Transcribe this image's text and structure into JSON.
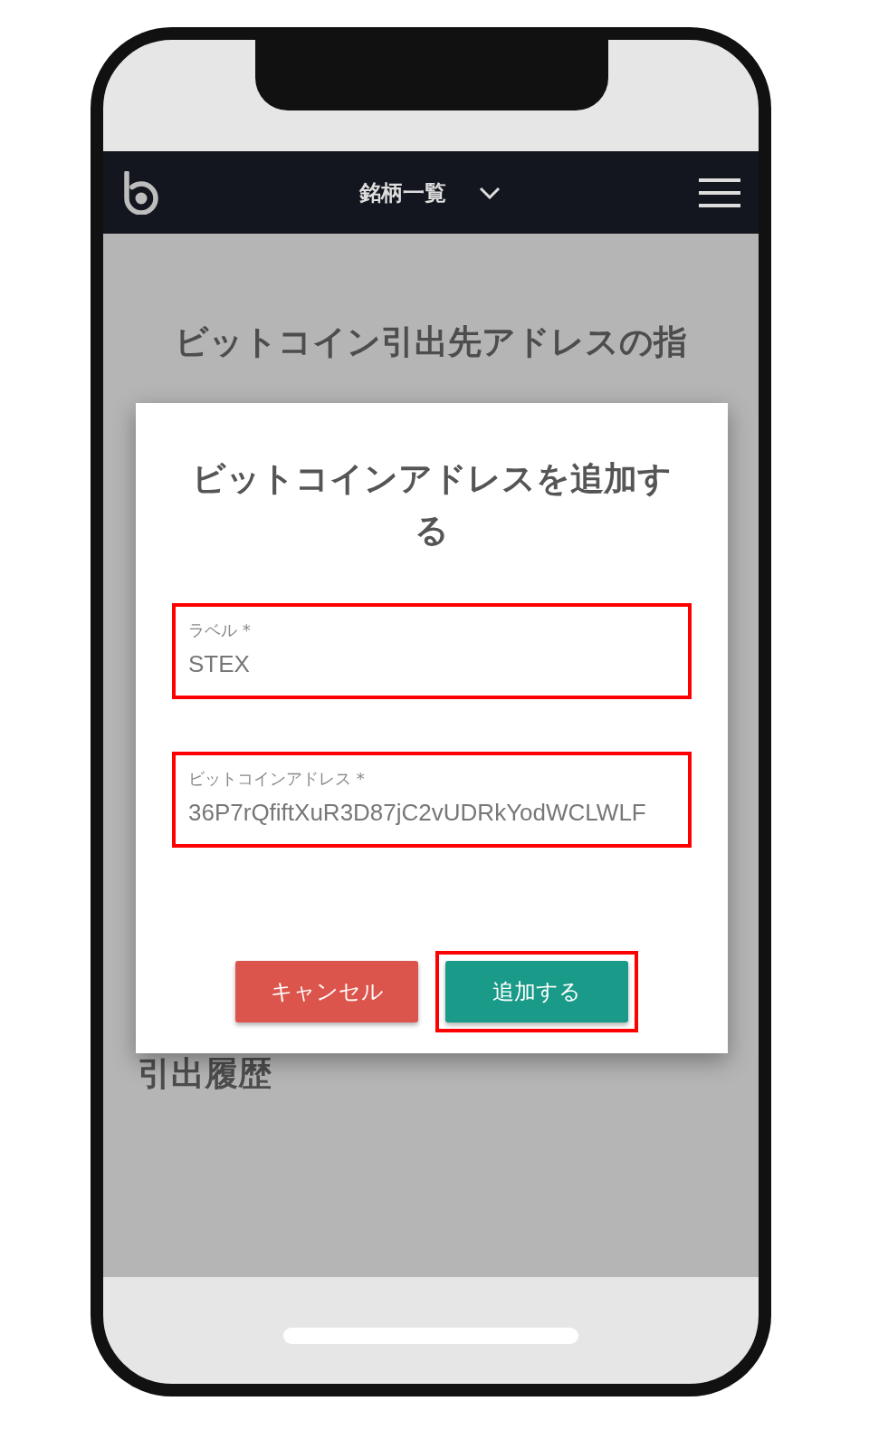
{
  "header": {
    "title": "銘柄一覧"
  },
  "page": {
    "title": "ビットコイン引出先アドレスの指",
    "history_heading": "引出履歴"
  },
  "dialog": {
    "title": "ビットコインアドレスを追加する",
    "fields": [
      {
        "label": "ラベル *",
        "value": "STEX",
        "highlighted": true
      },
      {
        "label": "ビットコインアドレス *",
        "value": "36P7rQfiftXuR3D87jC2vUDRkYodWCLWLF",
        "highlighted": true
      }
    ],
    "buttons": [
      {
        "label": "キャンセル",
        "kind": "cancel",
        "highlighted": false
      },
      {
        "label": "追加する",
        "kind": "primary",
        "highlighted": true
      }
    ]
  }
}
